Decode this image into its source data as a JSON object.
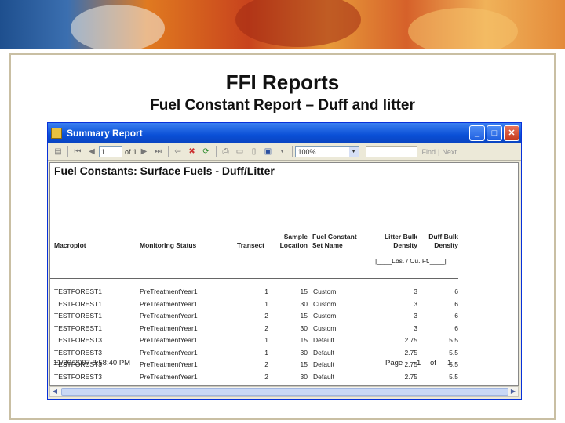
{
  "slide": {
    "title": "FFI Reports",
    "subtitle": "Fuel Constant Report – Duff and litter"
  },
  "window": {
    "title": "Summary Report",
    "buttons": {
      "minimize": "_",
      "maximize": "□",
      "close": "✕"
    }
  },
  "toolbar": {
    "page_value": "1",
    "of_label": "of",
    "page_total": "1",
    "zoom": "100%",
    "find_label": "Find",
    "next_label": "Next",
    "separator_label": "|"
  },
  "report": {
    "title": "Fuel Constants: Surface Fuels - Duff/Litter",
    "columns": {
      "macroplot": "Macroplot",
      "monitoring_status": "Monitoring Status",
      "transect": "Transect",
      "sample_location": [
        "Sample",
        "Location"
      ],
      "fuel_constant_set": [
        "Fuel Constant",
        "Set Name"
      ],
      "litter_bulk": [
        "Litter Bulk",
        "Density"
      ],
      "duff_bulk": [
        "Duff Bulk",
        "Density"
      ]
    },
    "units": "|____Lbs. / Cu. Ft.____|",
    "rows": [
      [
        "TESTFOREST1",
        "PreTreatmentYear1",
        "1",
        "15",
        "Custom",
        "3",
        "6"
      ],
      [
        "TESTFOREST1",
        "PreTreatmentYear1",
        "1",
        "30",
        "Custom",
        "3",
        "6"
      ],
      [
        "TESTFOREST1",
        "PreTreatmentYear1",
        "2",
        "15",
        "Custom",
        "3",
        "6"
      ],
      [
        "TESTFOREST1",
        "PreTreatmentYear1",
        "2",
        "30",
        "Custom",
        "3",
        "6"
      ],
      [
        "TESTFOREST3",
        "PreTreatmentYear1",
        "1",
        "15",
        "Default",
        "2.75",
        "5.5"
      ],
      [
        "TESTFOREST3",
        "PreTreatmentYear1",
        "1",
        "30",
        "Default",
        "2.75",
        "5.5"
      ],
      [
        "TESTFOREST3",
        "PreTreatmentYear1",
        "2",
        "15",
        "Default",
        "2.75",
        "5.5"
      ],
      [
        "TESTFOREST3",
        "PreTreatmentYear1",
        "2",
        "30",
        "Default",
        "2.75",
        "5.5"
      ]
    ],
    "footer_date": "11/30/2007 8:58:40 PM",
    "footer_page": "Page",
    "footer_page_num": "1",
    "footer_of": "of",
    "footer_page_total": "1"
  }
}
